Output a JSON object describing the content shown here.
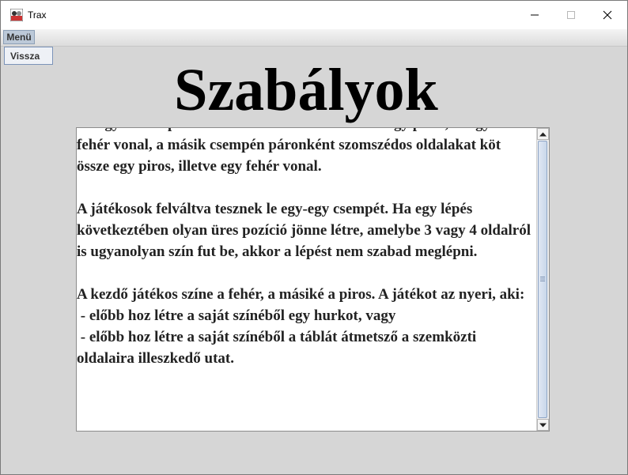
{
  "window": {
    "title": "Trax"
  },
  "menubar": {
    "menu_label": "Menü",
    "dropdown_item": "Vissza"
  },
  "page": {
    "heading": "Szabályok",
    "rules_paragraphs": [
      "Az egyik csempén két szemközti oldalt köt össze egy piros, és egy",
      "fehér vonal, a másik csempén páronként szomszédos oldalakat köt össze egy piros, illetve egy fehér vonal.",
      "",
      "A játékosok felváltva tesznek le egy-egy csempét. Ha egy lépés következtében olyan üres pozíció jönne létre, amelybe 3 vagy 4 oldalról is ugyanolyan szín fut be, akkor a lépést nem szabad meglépni.",
      "",
      "A kezdő játékos színe a fehér, a másiké a piros. A játékot az nyeri, aki:",
      " - előbb hoz létre a saját színéből egy hurkot, vagy",
      " - előbb hoz létre a saját színéből a táblát átmetsző a szemközti oldalaira illeszkedő utat."
    ]
  },
  "scroll": {
    "position": 0.97
  },
  "colors": {
    "window_bg": "#d6d6d6",
    "menu_highlight": "#bcc9d8",
    "scroll_thumb": "#c9d7ea"
  },
  "icons": {
    "app": "trax-app-icon",
    "minimize": "minimize-icon",
    "maximize": "maximize-icon",
    "close": "close-icon"
  }
}
